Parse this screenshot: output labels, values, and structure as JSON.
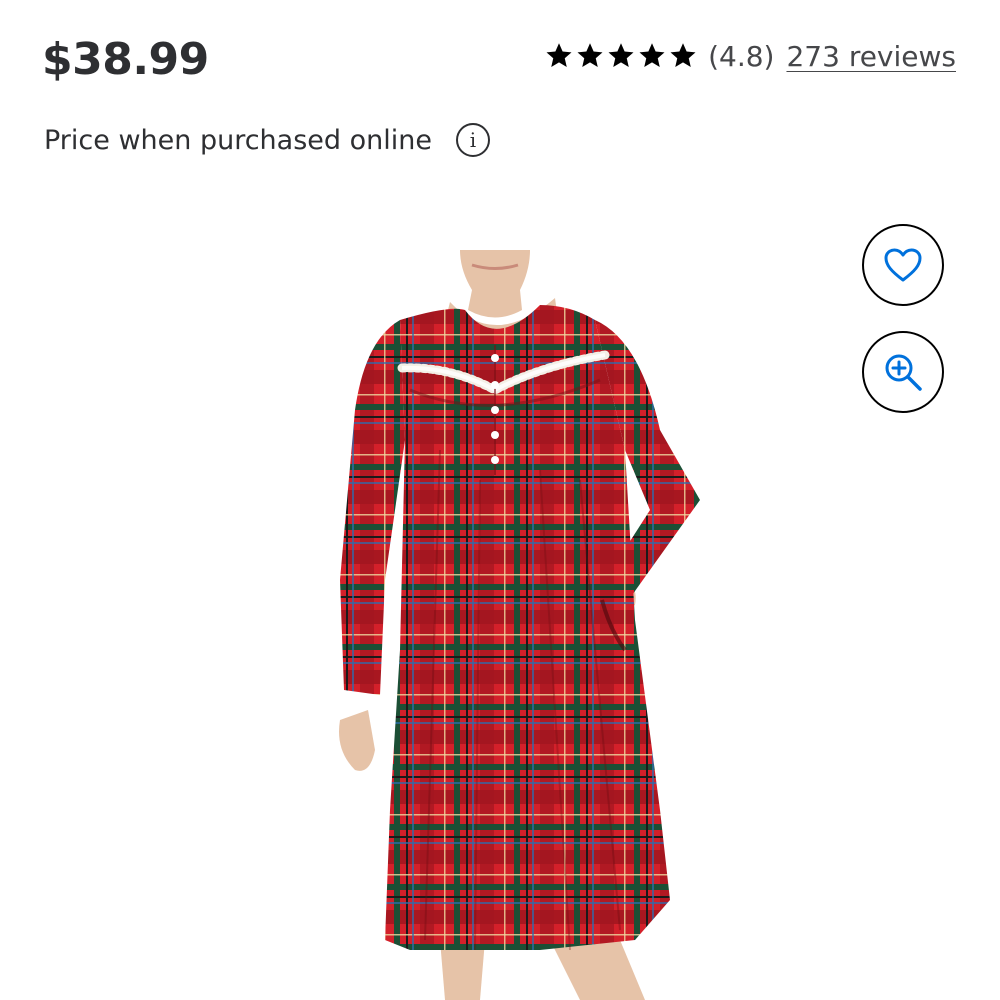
{
  "product": {
    "price": "$38.99",
    "price_note": "Price when purchased online",
    "info_glyph": "i",
    "rating": {
      "stars": 5,
      "value_text": "(4.8)",
      "reviews_text": "273 reviews"
    },
    "image": {
      "alt": "Red tartan plaid long-sleeve nightgown"
    },
    "actions": {
      "favorite_icon": "heart-icon",
      "zoom_icon": "zoom-in-icon"
    }
  },
  "colors": {
    "text": "#2e2f32",
    "icon_blue": "#0071dc",
    "plaid_red": "#d3202a",
    "plaid_green": "#1c4f35",
    "skin": "#e6c3a8"
  }
}
